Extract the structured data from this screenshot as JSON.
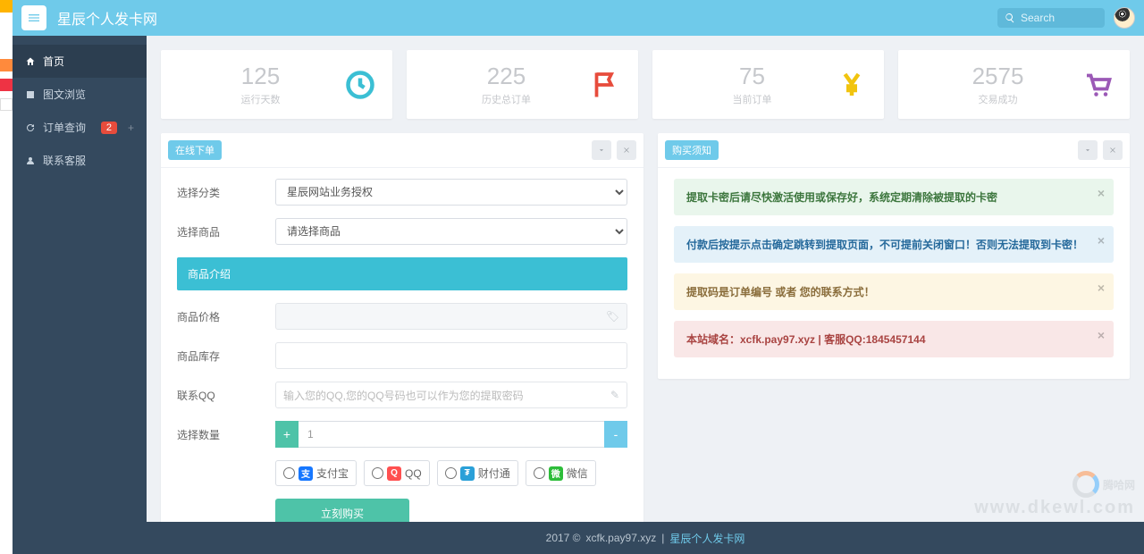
{
  "header": {
    "site_title": "星辰个人发卡网",
    "search_placeholder": "Search"
  },
  "sidebar": {
    "items": [
      {
        "label": "首页",
        "icon": "home",
        "active": true
      },
      {
        "label": "图文浏览",
        "icon": "image"
      },
      {
        "label": "订单查询",
        "icon": "refresh",
        "badge": "2",
        "plus": "+"
      },
      {
        "label": "联系客服",
        "icon": "user"
      }
    ]
  },
  "stats": [
    {
      "num": "125",
      "label": "运行天数",
      "icon": "clock",
      "color": "#3bbfd4"
    },
    {
      "num": "225",
      "label": "历史总订单",
      "icon": "flag",
      "color": "#e74c3c"
    },
    {
      "num": "75",
      "label": "当前订单",
      "icon": "yen",
      "color": "#f1c40f"
    },
    {
      "num": "2575",
      "label": "交易成功",
      "icon": "cart",
      "color": "#9b59b6"
    }
  ],
  "order_panel": {
    "title": "在线下单",
    "category_label": "选择分类",
    "category_value": "星辰网站业务授权",
    "product_label": "选择商品",
    "product_placeholder": "请选择商品",
    "intro_title": "商品介绍",
    "price_label": "商品价格",
    "stock_label": "商品库存",
    "qq_label": "联系QQ",
    "qq_placeholder": "输入您的QQ,您的QQ号码也可以作为您的提取密码",
    "qty_label": "选择数量",
    "qty_value": "1",
    "pay_opts": [
      {
        "label": "支付宝",
        "color": "#1677ff",
        "glyph": "支"
      },
      {
        "label": "QQ",
        "color": "#ff5050",
        "glyph": "Q"
      },
      {
        "label": "财付通",
        "color": "#2aa0d8",
        "glyph": "₮"
      },
      {
        "label": "微信",
        "color": "#2dbd3a",
        "glyph": "微"
      }
    ],
    "submit": "立刻购买"
  },
  "notice_panel": {
    "title": "购买须知",
    "alerts": [
      {
        "type": "success",
        "text": "提取卡密后请尽快激活使用或保存好，系统定期清除被提取的卡密"
      },
      {
        "type": "info",
        "text": "付款后按提示点击确定跳转到提取页面，不可提前关闭窗口！否则无法提取到卡密！"
      },
      {
        "type": "warning",
        "text": "提取码是订单编号 或者 您的联系方式！"
      },
      {
        "type": "danger",
        "text": "本站域名：xcfk.pay97.xyz | 客服QQ:1845457144"
      }
    ]
  },
  "footer": {
    "year": "2017 ©",
    "domain": "xcfk.pay97.xyz",
    "link": "星辰个人发卡网"
  },
  "watermark": {
    "l1": "腾哈网",
    "l2": "www.dkewl.com"
  }
}
